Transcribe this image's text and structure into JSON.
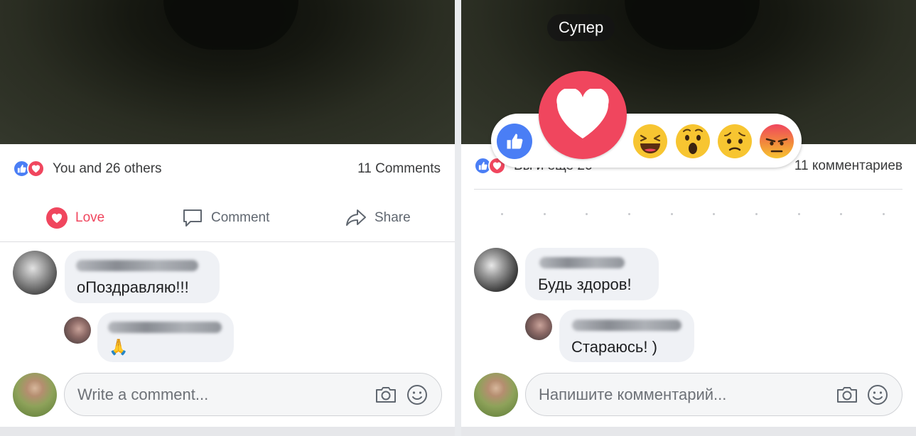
{
  "left": {
    "summary": {
      "text": "You and 26 others",
      "comments": "11 Comments"
    },
    "actions": {
      "love": "Love",
      "comment": "Comment",
      "share": "Share"
    },
    "comment1": {
      "text": "оПоздравляю!!!"
    },
    "comment2": {
      "emoji": "🙏"
    },
    "write": {
      "placeholder": "Write a comment..."
    }
  },
  "right": {
    "summary": {
      "text": "Вы и еще 26",
      "comments": "11 комментариев"
    },
    "tooltip": "Супер",
    "comment1": {
      "text": "Будь здоров!"
    },
    "comment2": {
      "text": "Стараюсь! )"
    },
    "write": {
      "placeholder": "Напишите комментарий..."
    }
  },
  "colors": {
    "like_blue": "#4a7ef5",
    "love_red": "#f0465e",
    "haha_yellow": "#f7c531",
    "angry_orange": "#f06b3c"
  },
  "icons": [
    "like-icon",
    "love-icon",
    "comment-icon",
    "share-icon",
    "camera-icon",
    "smiley-icon",
    "haha-icon",
    "wow-icon",
    "sad-icon",
    "angry-icon"
  ]
}
